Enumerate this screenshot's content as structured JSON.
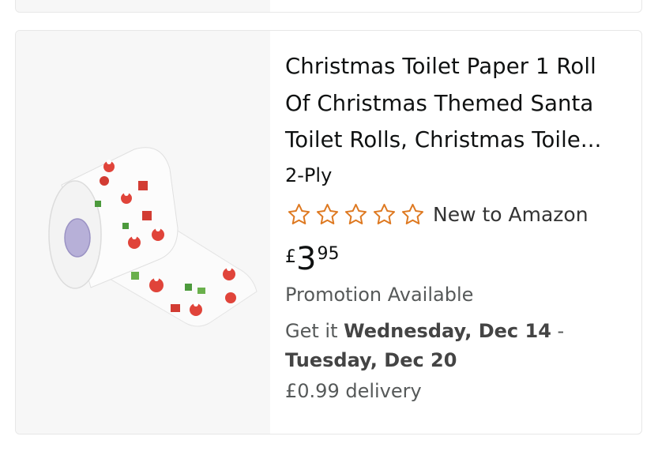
{
  "product": {
    "title": "Christmas Toilet Paper 1 Roll Of Christmas Themed Santa Toilet Rolls, Christmas Toile...",
    "variant": "2-Ply",
    "rating_stars": 0,
    "rating_text": "New to Amazon",
    "price": {
      "symbol": "£",
      "whole": "3",
      "fraction": "95"
    },
    "promotion": "Promotion Available",
    "delivery_prefix": "Get it ",
    "delivery_start": "Wednesday, Dec 14",
    "delivery_sep": " - ",
    "delivery_end": "Tuesday, Dec 20",
    "delivery_fee": "£0.99 delivery",
    "image_icon": "toilet-roll-santa-image"
  },
  "colors": {
    "star_outline": "#de7921",
    "image_bg": "#f7f7f7",
    "secondary_text": "#565959"
  }
}
